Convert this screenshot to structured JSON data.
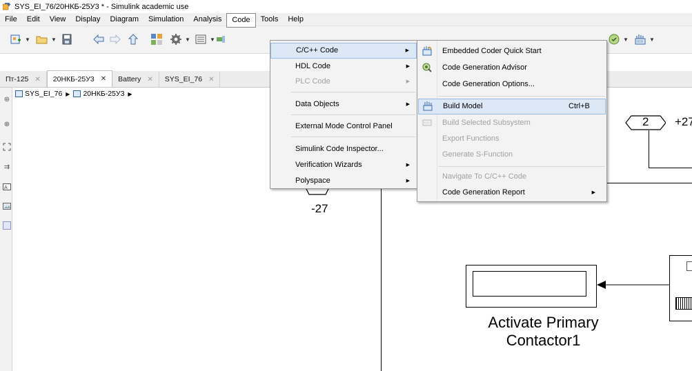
{
  "window": {
    "title": "SYS_EI_76/20НКБ-25У3 * - Simulink academic use"
  },
  "menubar": [
    "File",
    "Edit",
    "View",
    "Display",
    "Diagram",
    "Simulation",
    "Analysis",
    "Code",
    "Tools",
    "Help"
  ],
  "tabs": [
    {
      "label": "Пт-125"
    },
    {
      "label": "20НКБ-25У3"
    },
    {
      "label": "Battery"
    },
    {
      "label": "SYS_EI_76"
    }
  ],
  "breadcrumb": {
    "root": "SYS_EI_76",
    "child": "20НКБ-25У3"
  },
  "code_menu": {
    "items": [
      {
        "label": "C/C++ Code"
      },
      {
        "label": "HDL Code"
      },
      {
        "label": "PLC Code"
      },
      {
        "label": "Data Objects"
      },
      {
        "label": "External Mode Control Panel"
      },
      {
        "label": "Simulink Code Inspector..."
      },
      {
        "label": "Verification Wizards"
      },
      {
        "label": "Polyspace"
      }
    ]
  },
  "cpp_submenu": {
    "items": [
      {
        "label": "Embedded Coder Quick Start"
      },
      {
        "label": "Code Generation Advisor"
      },
      {
        "label": "Code Generation Options..."
      },
      {
        "label": "Build Model",
        "shortcut": "Ctrl+B"
      },
      {
        "label": "Build Selected Subsystem"
      },
      {
        "label": "Export Functions"
      },
      {
        "label": "Generate S-Function"
      },
      {
        "label": "Navigate To C/C++ Code"
      },
      {
        "label": "Code Generation Report"
      }
    ]
  },
  "canvas": {
    "goto_left_value": "-27",
    "goto_right_value": "2",
    "goto_right_suffix": "+27",
    "block_label_line1": "Activate Primary",
    "block_label_line2": "Contactor1"
  }
}
